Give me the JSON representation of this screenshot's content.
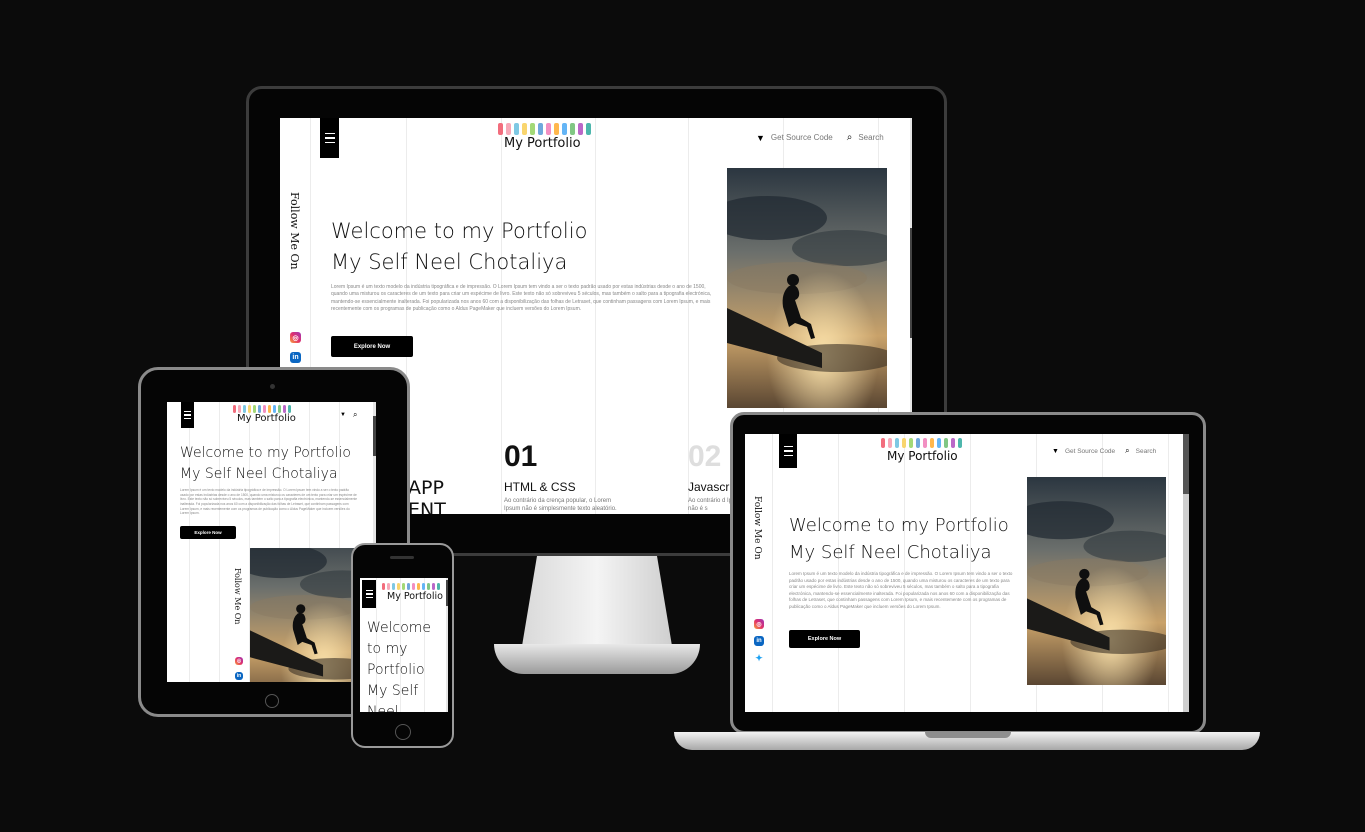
{
  "site": {
    "logo": "My Portfolio",
    "nav_source": "Get Source Code",
    "nav_search": "Search",
    "heading_line1": "Welcome to my Portfolio",
    "heading_line2": "My Self Neel Chotaliya",
    "intro": "Lorem Ipsum é um texto modelo da indústria tipográfica e de impressão. O Lorem Ipsum tem vindo a ser o texto padrão usado por estas indústrias desde o ano de 1500, quando uma misturou os caracteres de um texto para criar um espécime de livro. Este texto não só sobreviveu 5 séculos, mas também o salto para a tipografia electrónica, mantendo-se essencialmente inalterada. Foi popularizada nos anos 60 com a disponibilização das folhas de Letraset, que continham passagens com Lorem Ipsum, e mais recentemente com os programas de publicação como o Aldus PageMaker que incluem versões do Lorem Ipsum.",
    "cta": "Explore Now",
    "follow": "Follow Me On",
    "mobile_heading": "Welcome to my Portfolio My Self Neel",
    "accent_colors": [
      "#f26d7d",
      "#f7a8b8",
      "#7ec8e3",
      "#f9d56e",
      "#a3d977",
      "#6fa8dc",
      "#f28fc2",
      "#ffb74d",
      "#64b5f6",
      "#81c784",
      "#ba68c8",
      "#4db6ac"
    ]
  },
  "skills": [
    {
      "number": "01",
      "title": "HTML & CSS",
      "desc": "Ao contrário da crença popular, o Lorem Ipsum não é simplesmente texto aleatório."
    },
    {
      "number": "02",
      "title": "Javascr",
      "desc": "Ao contrário d Ipsum não é s"
    }
  ],
  "app_text": {
    "line1": "APP",
    "line2": "ENT"
  },
  "icons": {
    "menu": "hamburger-icon",
    "source": "gitlab-icon",
    "search": "search-icon",
    "instagram": "instagram-icon",
    "linkedin": "linkedin-icon",
    "twitter": "twitter-icon"
  }
}
